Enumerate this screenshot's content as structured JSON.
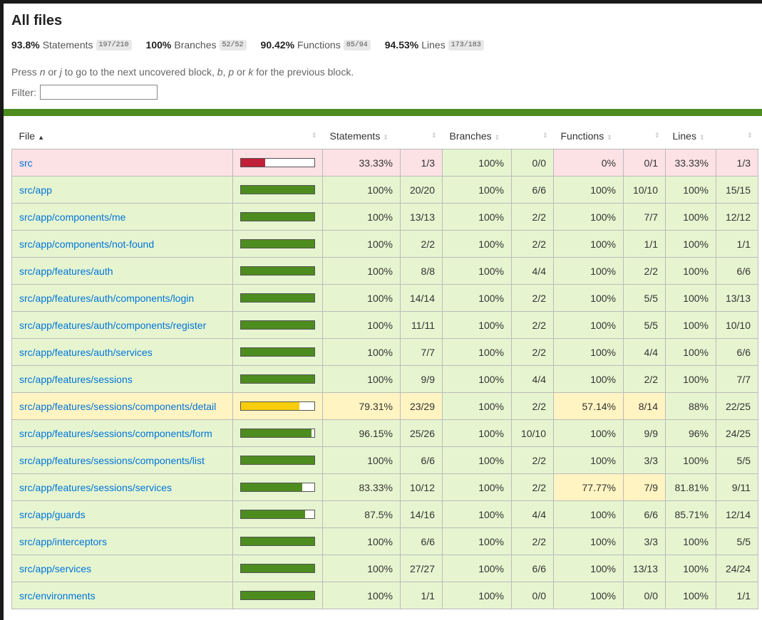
{
  "header": {
    "title": "All files",
    "stats": [
      {
        "pct": "93.8%",
        "label": "Statements",
        "fraction": "197/210"
      },
      {
        "pct": "100%",
        "label": "Branches",
        "fraction": "52/52"
      },
      {
        "pct": "90.42%",
        "label": "Functions",
        "fraction": "85/94"
      },
      {
        "pct": "94.53%",
        "label": "Lines",
        "fraction": "173/183"
      }
    ],
    "hint_parts": [
      "Press ",
      "n",
      " or ",
      "j",
      " to go to the next uncovered block, ",
      "b",
      ", ",
      "p",
      " or ",
      "k",
      " for the previous block."
    ],
    "filter_label": "Filter:",
    "filter_value": ""
  },
  "columns": {
    "file": "File",
    "statements": "Statements",
    "branches": "Branches",
    "functions": "Functions",
    "lines": "Lines",
    "sort_asc_glyph": "▲",
    "sort_glyph": "⇕"
  },
  "colors": {
    "high": "#4d8c1f",
    "medium": "#f9cd0b",
    "low": "#c21f39",
    "link": "#0074d9"
  },
  "rows": [
    {
      "file": "src",
      "pct": 0.3333,
      "level": "low",
      "stmt_pct": "33.33%",
      "stmt": "1/3",
      "stmt_lvl": "low",
      "br_pct": "100%",
      "br": "0/0",
      "br_lvl": "high",
      "fn_pct": "0%",
      "fn": "0/1",
      "fn_lvl": "low",
      "ln_pct": "33.33%",
      "ln": "1/3",
      "ln_lvl": "low"
    },
    {
      "file": "src/app",
      "pct": 1,
      "level": "high",
      "stmt_pct": "100%",
      "stmt": "20/20",
      "stmt_lvl": "high",
      "br_pct": "100%",
      "br": "6/6",
      "br_lvl": "high",
      "fn_pct": "100%",
      "fn": "10/10",
      "fn_lvl": "high",
      "ln_pct": "100%",
      "ln": "15/15",
      "ln_lvl": "high"
    },
    {
      "file": "src/app/components/me",
      "pct": 1,
      "level": "high",
      "stmt_pct": "100%",
      "stmt": "13/13",
      "stmt_lvl": "high",
      "br_pct": "100%",
      "br": "2/2",
      "br_lvl": "high",
      "fn_pct": "100%",
      "fn": "7/7",
      "fn_lvl": "high",
      "ln_pct": "100%",
      "ln": "12/12",
      "ln_lvl": "high"
    },
    {
      "file": "src/app/components/not-found",
      "pct": 1,
      "level": "high",
      "stmt_pct": "100%",
      "stmt": "2/2",
      "stmt_lvl": "high",
      "br_pct": "100%",
      "br": "2/2",
      "br_lvl": "high",
      "fn_pct": "100%",
      "fn": "1/1",
      "fn_lvl": "high",
      "ln_pct": "100%",
      "ln": "1/1",
      "ln_lvl": "high"
    },
    {
      "file": "src/app/features/auth",
      "pct": 1,
      "level": "high",
      "stmt_pct": "100%",
      "stmt": "8/8",
      "stmt_lvl": "high",
      "br_pct": "100%",
      "br": "4/4",
      "br_lvl": "high",
      "fn_pct": "100%",
      "fn": "2/2",
      "fn_lvl": "high",
      "ln_pct": "100%",
      "ln": "6/6",
      "ln_lvl": "high"
    },
    {
      "file": "src/app/features/auth/components/login",
      "pct": 1,
      "level": "high",
      "stmt_pct": "100%",
      "stmt": "14/14",
      "stmt_lvl": "high",
      "br_pct": "100%",
      "br": "2/2",
      "br_lvl": "high",
      "fn_pct": "100%",
      "fn": "5/5",
      "fn_lvl": "high",
      "ln_pct": "100%",
      "ln": "13/13",
      "ln_lvl": "high"
    },
    {
      "file": "src/app/features/auth/components/register",
      "pct": 1,
      "level": "high",
      "stmt_pct": "100%",
      "stmt": "11/11",
      "stmt_lvl": "high",
      "br_pct": "100%",
      "br": "2/2",
      "br_lvl": "high",
      "fn_pct": "100%",
      "fn": "5/5",
      "fn_lvl": "high",
      "ln_pct": "100%",
      "ln": "10/10",
      "ln_lvl": "high"
    },
    {
      "file": "src/app/features/auth/services",
      "pct": 1,
      "level": "high",
      "stmt_pct": "100%",
      "stmt": "7/7",
      "stmt_lvl": "high",
      "br_pct": "100%",
      "br": "2/2",
      "br_lvl": "high",
      "fn_pct": "100%",
      "fn": "4/4",
      "fn_lvl": "high",
      "ln_pct": "100%",
      "ln": "6/6",
      "ln_lvl": "high"
    },
    {
      "file": "src/app/features/sessions",
      "pct": 1,
      "level": "high",
      "stmt_pct": "100%",
      "stmt": "9/9",
      "stmt_lvl": "high",
      "br_pct": "100%",
      "br": "4/4",
      "br_lvl": "high",
      "fn_pct": "100%",
      "fn": "2/2",
      "fn_lvl": "high",
      "ln_pct": "100%",
      "ln": "7/7",
      "ln_lvl": "high"
    },
    {
      "file": "src/app/features/sessions/components/detail",
      "pct": 0.7931,
      "level": "medium",
      "stmt_pct": "79.31%",
      "stmt": "23/29",
      "stmt_lvl": "medium",
      "br_pct": "100%",
      "br": "2/2",
      "br_lvl": "high",
      "fn_pct": "57.14%",
      "fn": "8/14",
      "fn_lvl": "medium",
      "ln_pct": "88%",
      "ln": "22/25",
      "ln_lvl": "high"
    },
    {
      "file": "src/app/features/sessions/components/form",
      "pct": 0.9615,
      "level": "high",
      "stmt_pct": "96.15%",
      "stmt": "25/26",
      "stmt_lvl": "high",
      "br_pct": "100%",
      "br": "10/10",
      "br_lvl": "high",
      "fn_pct": "100%",
      "fn": "9/9",
      "fn_lvl": "high",
      "ln_pct": "96%",
      "ln": "24/25",
      "ln_lvl": "high"
    },
    {
      "file": "src/app/features/sessions/components/list",
      "pct": 1,
      "level": "high",
      "stmt_pct": "100%",
      "stmt": "6/6",
      "stmt_lvl": "high",
      "br_pct": "100%",
      "br": "2/2",
      "br_lvl": "high",
      "fn_pct": "100%",
      "fn": "3/3",
      "fn_lvl": "high",
      "ln_pct": "100%",
      "ln": "5/5",
      "ln_lvl": "high"
    },
    {
      "file": "src/app/features/sessions/services",
      "pct": 0.8333,
      "level": "high",
      "stmt_pct": "83.33%",
      "stmt": "10/12",
      "stmt_lvl": "high",
      "br_pct": "100%",
      "br": "2/2",
      "br_lvl": "high",
      "fn_pct": "77.77%",
      "fn": "7/9",
      "fn_lvl": "medium",
      "ln_pct": "81.81%",
      "ln": "9/11",
      "ln_lvl": "high"
    },
    {
      "file": "src/app/guards",
      "pct": 0.875,
      "level": "high",
      "stmt_pct": "87.5%",
      "stmt": "14/16",
      "stmt_lvl": "high",
      "br_pct": "100%",
      "br": "4/4",
      "br_lvl": "high",
      "fn_pct": "100%",
      "fn": "6/6",
      "fn_lvl": "high",
      "ln_pct": "85.71%",
      "ln": "12/14",
      "ln_lvl": "high"
    },
    {
      "file": "src/app/interceptors",
      "pct": 1,
      "level": "high",
      "stmt_pct": "100%",
      "stmt": "6/6",
      "stmt_lvl": "high",
      "br_pct": "100%",
      "br": "2/2",
      "br_lvl": "high",
      "fn_pct": "100%",
      "fn": "3/3",
      "fn_lvl": "high",
      "ln_pct": "100%",
      "ln": "5/5",
      "ln_lvl": "high"
    },
    {
      "file": "src/app/services",
      "pct": 1,
      "level": "high",
      "stmt_pct": "100%",
      "stmt": "27/27",
      "stmt_lvl": "high",
      "br_pct": "100%",
      "br": "6/6",
      "br_lvl": "high",
      "fn_pct": "100%",
      "fn": "13/13",
      "fn_lvl": "high",
      "ln_pct": "100%",
      "ln": "24/24",
      "ln_lvl": "high"
    },
    {
      "file": "src/environments",
      "pct": 1,
      "level": "high",
      "stmt_pct": "100%",
      "stmt": "1/1",
      "stmt_lvl": "high",
      "br_pct": "100%",
      "br": "0/0",
      "br_lvl": "high",
      "fn_pct": "100%",
      "fn": "0/0",
      "fn_lvl": "high",
      "ln_pct": "100%",
      "ln": "1/1",
      "ln_lvl": "high"
    }
  ]
}
